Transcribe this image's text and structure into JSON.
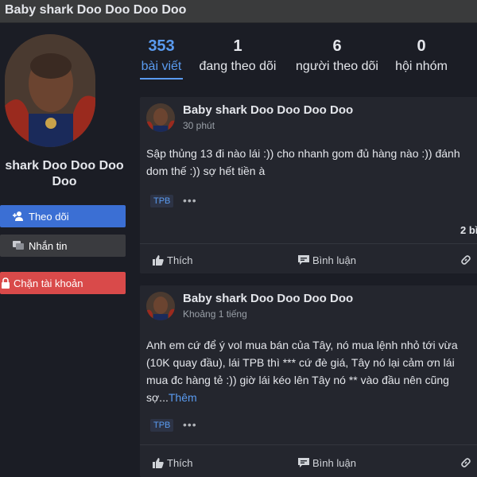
{
  "header": {
    "title": "Baby shark Doo Doo Doo Doo"
  },
  "profile": {
    "name_line1": "shark Doo Doo Doo",
    "name_line2": "Doo",
    "buttons": {
      "follow": "Theo dõi",
      "message": "Nhắn tin",
      "block": "Chặn tài khoản"
    }
  },
  "stats": [
    {
      "value": "353",
      "label": "bài viết",
      "active": true
    },
    {
      "value": "1",
      "label": "đang theo dõi"
    },
    {
      "value": "6",
      "label": "người theo dõi"
    },
    {
      "value": "0",
      "label": "hội nhóm"
    }
  ],
  "posts": [
    {
      "author": "Baby shark Doo Doo Doo Doo",
      "time": "30 phút",
      "lines": [
        "Sập thủng 13 đi nào lái :)) cho nhanh gom đủ hàng nào :)) đánh",
        "dom thế :)) sợ hết tiền à"
      ],
      "tag": "TPB",
      "more_icon": "•••",
      "count": "2 bì",
      "actions": {
        "like": "Thích",
        "comment": "Bình luận"
      }
    },
    {
      "author": "Baby shark Doo Doo Doo Doo",
      "time": "Khoảng 1 tiếng",
      "lines": [
        "Anh em cứ để ý vol mua bán của Tây, nó mua lệnh nhỏ tới vừa",
        "(10K quay đầu), lái TPB thì *** cứ đè giá, Tây nó lại cảm ơn lái",
        "mua đc hàng tẻ :)) giờ lái kéo lên Tây nó ** vào đầu nên cũng",
        "sợ..."
      ],
      "see_more": "Thêm",
      "tag": "TPB",
      "more_icon": "•••",
      "actions": {
        "like": "Thích",
        "comment": "Bình luận"
      }
    }
  ],
  "colors": {
    "accent": "#5a9bf0",
    "follow": "#3b6fd4",
    "block": "#d94a4a",
    "card": "#24262e",
    "background": "#1b1d25"
  },
  "icons": [
    "follow-user-icon",
    "message-icon",
    "lock-icon",
    "like-icon",
    "comment-icon",
    "link-icon",
    "more-icon"
  ]
}
